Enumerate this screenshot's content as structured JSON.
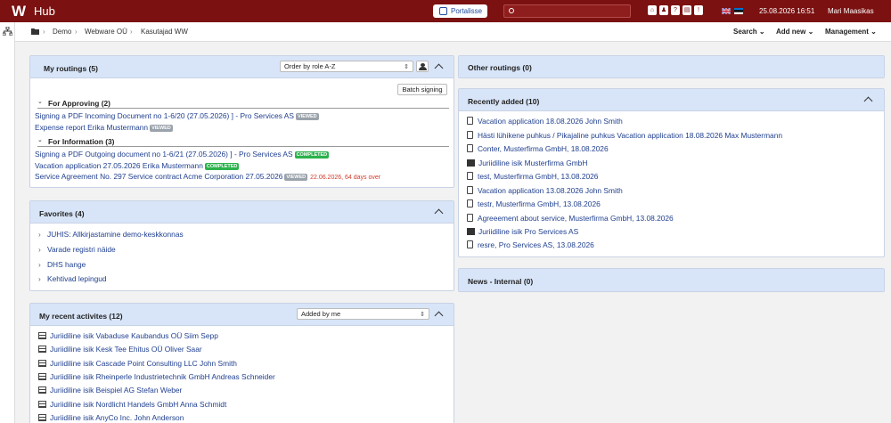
{
  "app": {
    "logo": "W",
    "name": "Hub",
    "portal_label": "Portalisse",
    "date": "25.08.2026 16:51",
    "user": "Mari Maasikas"
  },
  "breadcrumb": [
    "Demo",
    "Webware OÜ",
    "Kasutajad WW"
  ],
  "nav": {
    "search": "Search",
    "add_new": "Add new",
    "management": "Management"
  },
  "my_routings": {
    "title": "My routings (5)",
    "order_select": "Order by role A-Z",
    "batch_label": "Batch signing",
    "approving": {
      "header": "For Approving (2)",
      "items": [
        {
          "text": "Signing a PDF Incoming Document no 1-6/20 (27.05.2026) ] - Pro Services AS",
          "badge": "VIEWED"
        },
        {
          "text": "Expense report Erika Mustermann",
          "badge": "VIEWED"
        }
      ]
    },
    "information": {
      "header": "For Information (3)",
      "items": [
        {
          "text": "Signing a PDF Outgoing document no 1-6/21 (27.05.2026) ] - Pro Services AS",
          "badge": "COMPLETED"
        },
        {
          "text": "Vacation application 27.05.2026 Erika Mustermann",
          "badge": "COMPLETED"
        },
        {
          "text": "Service Agreement No. 297 Service contract Acme Corporation 27.05.2026",
          "badge": "VIEWED",
          "overdue": "22.06.2026, 64 days over"
        }
      ]
    }
  },
  "favorites": {
    "title": "Favorites (4)",
    "items": [
      "JUHIS: Allkirjastamine demo-keskkonnas",
      "Varade registri näide",
      "DHS hange",
      "Kehtivad lepingud"
    ]
  },
  "recent_activities": {
    "title": "My recent activites (12)",
    "filter": "Added by me",
    "items": [
      "Juriidiline isik Vabaduse Kaubandus OÜ Siim Sepp",
      "Juriidiline isik Kesk Tee Ehitus OÜ Oliver Saar",
      "Juriidiline isik Cascade Point Consulting LLC John Smith",
      "Juriidiline isik Rheinperle Industrietechnik GmbH Andreas Schneider",
      "Juriidiline isik Beispiel AG Stefan Weber",
      "Juriidiline isik Nordlicht Handels GmbH Anna Schmidt",
      "Juriidiline isik AnyCo Inc. John Anderson"
    ]
  },
  "other_routings": {
    "title": "Other routings (0)"
  },
  "recently_added": {
    "title": "Recently added (10)",
    "items": [
      {
        "text": "Vacation application 18.08.2026 John Smith",
        "icon": "document-icon"
      },
      {
        "text": "Hästi lühikene puhkus / Pikajaline puhkus Vacation application 18.08.2026 Max Mustermann",
        "icon": "document-icon"
      },
      {
        "text": "Conter, Musterfirma GmbH, 18.08.2026",
        "icon": "document-icon"
      },
      {
        "text": "Juriidiline isik Musterfirma GmbH",
        "icon": "entity-icon"
      },
      {
        "text": "test, Musterfirma GmbH, 13.08.2026",
        "icon": "document-icon"
      },
      {
        "text": "Vacation application 13.08.2026 John Smith",
        "icon": "document-icon"
      },
      {
        "text": "testr, Musterfirma GmbH, 13.08.2026",
        "icon": "document-icon"
      },
      {
        "text": "Agreeement about service, Musterfirma GmbH, 13.08.2026",
        "icon": "document-icon"
      },
      {
        "text": "Juriidiline isik Pro Services AS",
        "icon": "entity-icon"
      },
      {
        "text": "resre, Pro Services AS, 13.08.2026",
        "icon": "document-icon"
      }
    ]
  },
  "news": {
    "title": "News - Internal (0)"
  }
}
